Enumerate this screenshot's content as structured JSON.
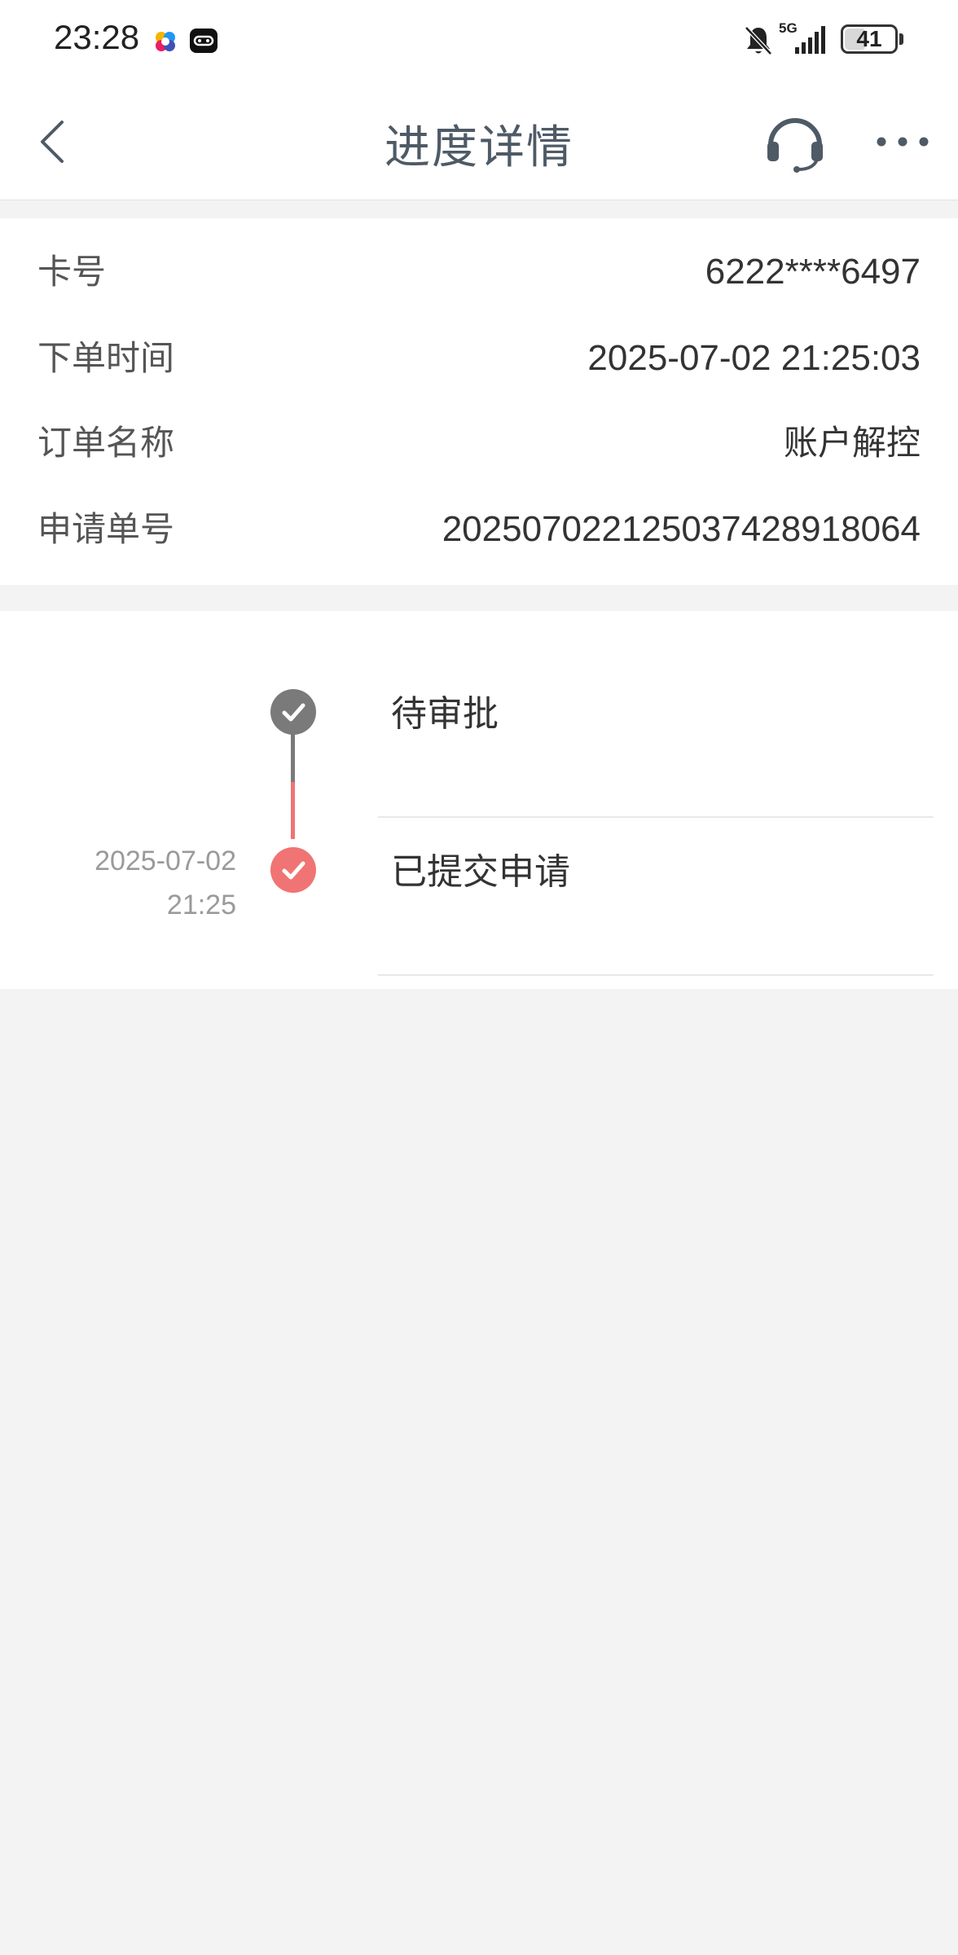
{
  "status_bar": {
    "time": "23:28",
    "network": "5G",
    "battery": "41",
    "battery_level": 0.41,
    "icons": [
      "colorful-app-icon",
      "game-controller-icon",
      "bell-muted-icon",
      "signal-icon",
      "battery-icon"
    ]
  },
  "nav": {
    "title": "进度详情",
    "icons": [
      "back-arrow-icon",
      "headset-icon",
      "more-dots-icon"
    ]
  },
  "info": {
    "rows": [
      {
        "label": "卡号",
        "value": "6222****6497"
      },
      {
        "label": "下单时间",
        "value": "2025-07-02 21:25:03"
      },
      {
        "label": "订单名称",
        "value": "账户解控"
      },
      {
        "label": "申请单号",
        "value": "202507022125037428918064"
      }
    ]
  },
  "timeline": {
    "steps": [
      {
        "title": "待审批",
        "date": "",
        "time": "",
        "status_color": "#7a7a7a"
      },
      {
        "title": "已提交申请",
        "date": "2025-07-02",
        "time": "21:25",
        "status_color": "#f07474"
      }
    ]
  },
  "colors": {
    "accent_red": "#f07474",
    "neutral_gray": "#7a7a7a",
    "title_text": "#4e5a66",
    "background": "#f3f3f3"
  }
}
